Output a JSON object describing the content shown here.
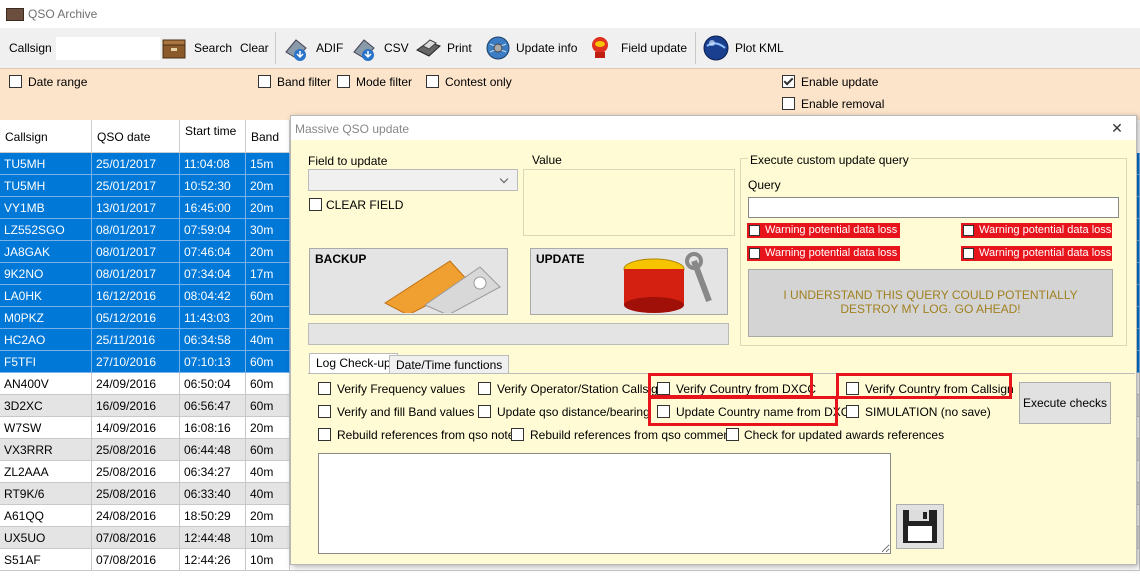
{
  "window": {
    "title": "QSO Archive"
  },
  "toolbar": {
    "callsign_label": "Callsign",
    "callsign_value": "",
    "search": "Search",
    "clear": "Clear",
    "adif": "ADIF",
    "csv": "CSV",
    "print": "Print",
    "update_info": "Update info",
    "field_update": "Field update",
    "plot_kml": "Plot KML"
  },
  "filters": {
    "date_range": "Date range",
    "band_filter": "Band filter",
    "mode_filter": "Mode filter",
    "contest_only": "Contest only",
    "enable_update": "Enable update",
    "enable_update_checked": true,
    "enable_removal": "Enable removal"
  },
  "grid": {
    "columns": [
      "Callsign",
      "QSO date",
      "Start time",
      "Band"
    ],
    "rows": [
      {
        "callsign": "TU5MH",
        "date": "25/01/2017",
        "time": "11:04:08",
        "band": "15m",
        "state": "sel"
      },
      {
        "callsign": "TU5MH",
        "date": "25/01/2017",
        "time": "10:52:30",
        "band": "20m",
        "state": "sel"
      },
      {
        "callsign": "VY1MB",
        "date": "13/01/2017",
        "time": "16:45:00",
        "band": "20m",
        "state": "sel"
      },
      {
        "callsign": "LZ552SGO",
        "date": "08/01/2017",
        "time": "07:59:04",
        "band": "30m",
        "state": "sel"
      },
      {
        "callsign": "JA8GAK",
        "date": "08/01/2017",
        "time": "07:46:04",
        "band": "20m",
        "state": "sel"
      },
      {
        "callsign": "9K2NO",
        "date": "08/01/2017",
        "time": "07:34:04",
        "band": "17m",
        "state": "sel"
      },
      {
        "callsign": "LA0HK",
        "date": "16/12/2016",
        "time": "08:04:42",
        "band": "60m",
        "state": "sel"
      },
      {
        "callsign": "M0PKZ",
        "date": "05/12/2016",
        "time": "11:43:03",
        "band": "20m",
        "state": "sel"
      },
      {
        "callsign": "HC2AO",
        "date": "25/11/2016",
        "time": "06:34:58",
        "band": "40m",
        "state": "sel"
      },
      {
        "callsign": "F5TFI",
        "date": "27/10/2016",
        "time": "07:10:13",
        "band": "60m",
        "state": "sel"
      },
      {
        "callsign": "AN400V",
        "date": "24/09/2016",
        "time": "06:50:04",
        "band": "60m",
        "state": "norm"
      },
      {
        "callsign": "3D2XC",
        "date": "16/09/2016",
        "time": "06:56:47",
        "band": "60m",
        "state": "alt"
      },
      {
        "callsign": "W7SW",
        "date": "14/09/2016",
        "time": "16:08:16",
        "band": "20m",
        "state": "norm"
      },
      {
        "callsign": "VX3RRR",
        "date": "25/08/2016",
        "time": "06:44:48",
        "band": "60m",
        "state": "alt"
      },
      {
        "callsign": "ZL2AAA",
        "date": "25/08/2016",
        "time": "06:34:27",
        "band": "40m",
        "state": "norm"
      },
      {
        "callsign": "RT9K/6",
        "date": "25/08/2016",
        "time": "06:33:40",
        "band": "40m",
        "state": "alt"
      },
      {
        "callsign": "A61QQ",
        "date": "24/08/2016",
        "time": "18:50:29",
        "band": "20m",
        "state": "norm"
      },
      {
        "callsign": "UX5UO",
        "date": "07/08/2016",
        "time": "12:44:48",
        "band": "10m",
        "state": "alt"
      },
      {
        "callsign": "S51AF",
        "date": "07/08/2016",
        "time": "12:44:26",
        "band": "10m",
        "state": "norm"
      }
    ]
  },
  "dialog": {
    "title": "Massive QSO update",
    "field_to_update": "Field to update",
    "value": "Value",
    "clear_field": "CLEAR FIELD",
    "backup": "BACKUP",
    "update": "UPDATE",
    "custom_query_group": "Execute custom update query",
    "query_label": "Query",
    "warning": "Warning potential data loss",
    "understand": "I UNDERSTAND THIS QUERY COULD POTENTIALLY DESTROY MY LOG. GO AHEAD!",
    "tabs": [
      "Log Check-up",
      "Date/Time functions"
    ],
    "checks": {
      "verify_frequency": "Verify Frequency values",
      "verify_operator": "Verify Operator/Station Callsign",
      "verify_country_dxcc": "Verify Country from DXCC",
      "verify_country_callsign": "Verify Country from Callsign",
      "verify_fill_band": "Verify and fill Band values",
      "update_distance": "Update qso distance/bearing",
      "update_country_name": "Update Country name from DXCC",
      "simulation": "SIMULATION (no save)",
      "rebuild_notes": "Rebuild references from qso notes",
      "rebuild_comments": "Rebuild references from qso comments",
      "check_awards": "Check for updated awards references"
    },
    "execute_checks": "Execute checks"
  },
  "colors": {
    "selection": "#0078d7",
    "dialog_bg": "#fffbd4",
    "filter_bg": "#fce4cb",
    "warning": "#e8141c",
    "highlight": "#e8141c"
  }
}
